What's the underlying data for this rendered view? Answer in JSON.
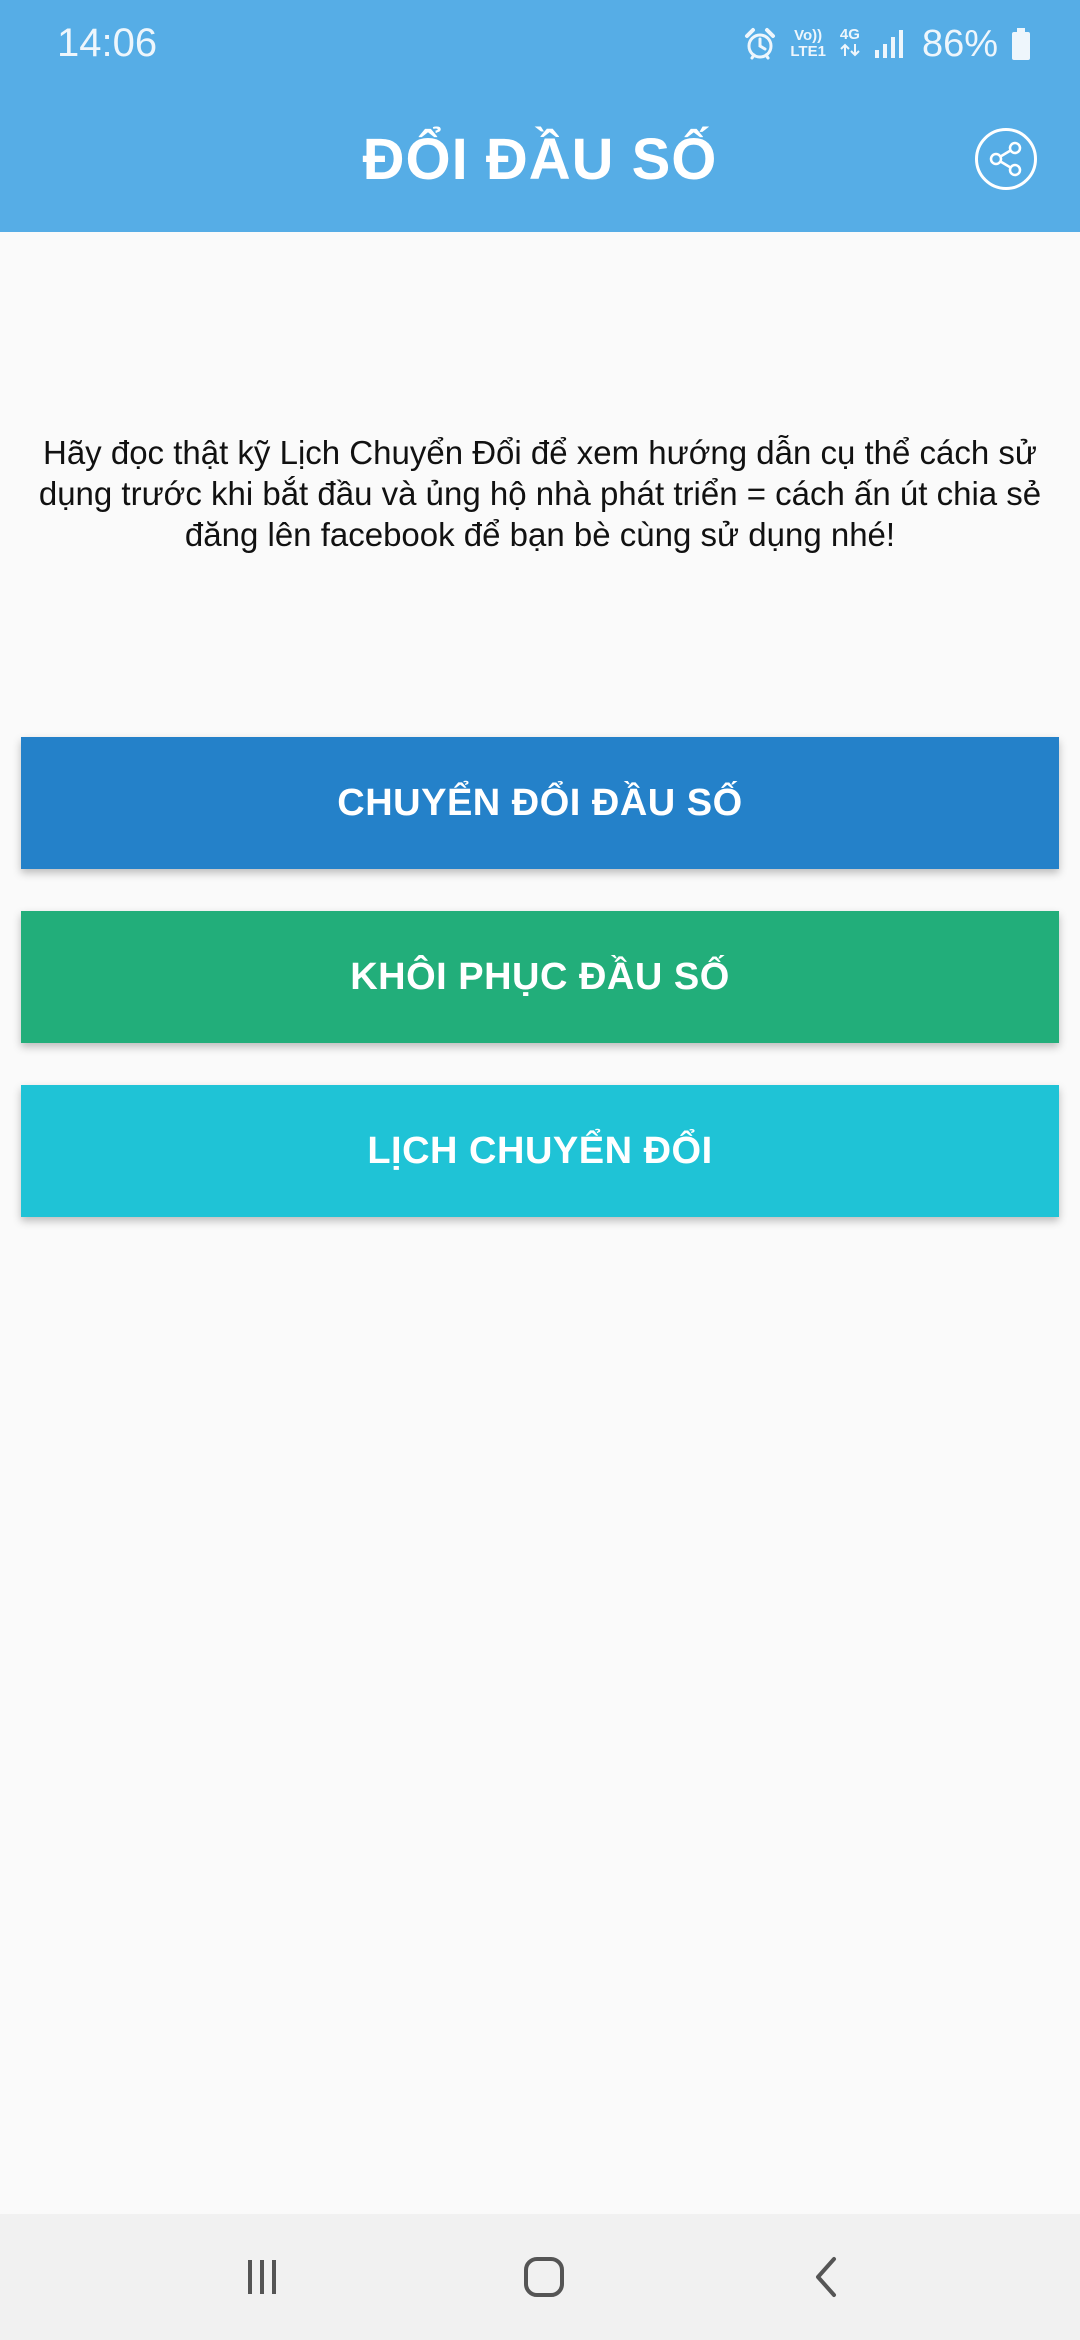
{
  "status_bar": {
    "time": "14:06",
    "net_top": "Vo))",
    "net_bottom": "LTE1",
    "net_type": "4G",
    "battery_percent": "86%",
    "icons": [
      "alarm-icon",
      "volte-icon",
      "4g-data-icon",
      "signal-icon",
      "battery-icon"
    ]
  },
  "header": {
    "title": "ĐỔI ĐẦU SỐ",
    "share_icon": "share-icon",
    "background_color": "#56ade6"
  },
  "main": {
    "intro_text": "Hãy đọc thật kỹ Lịch Chuyển Đổi để xem hướng dẫn cụ thể cách sử dụng trước khi bắt đầu và ủng hộ nhà phát triển = cách ấn út chia sẻ đăng lên facebook để bạn bè cùng sử dụng nhé!",
    "buttons": [
      {
        "label": "CHUYỂN ĐỔI ĐẦU SỐ",
        "color": "#2481c9"
      },
      {
        "label": "KHÔI PHỤC ĐẦU SỐ",
        "color": "#22ae7a"
      },
      {
        "label": "LỊCH CHUYỂN ĐỔI",
        "color": "#1fc3d6"
      }
    ]
  },
  "nav_bar": {
    "icons": [
      "recent-apps-icon",
      "home-icon",
      "back-icon"
    ]
  }
}
